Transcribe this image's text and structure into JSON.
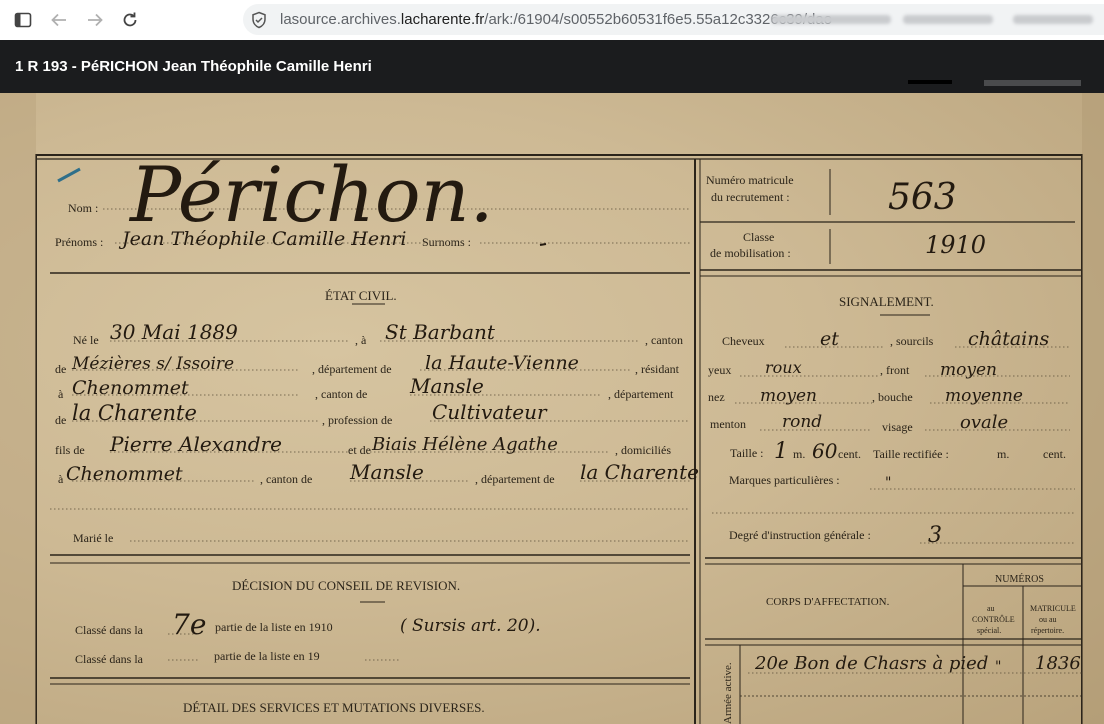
{
  "browser": {
    "url_prefix": "lasource.archives.",
    "url_host": "lacharente.fr",
    "url_path": "/ark:/61904/s00552b60531f6e5.55a12c3326c39/dao"
  },
  "viewer": {
    "title": "1 R 193 - PéRICHON Jean Théophile Camille Henri"
  },
  "document": {
    "nom_label": "Nom :",
    "nom_value": "Périchon.",
    "prenoms_label": "Prénoms :",
    "prenoms_value": "Jean Théophile Camille Henri",
    "surnoms_label": "Surnoms :",
    "matricule_label_1": "Numéro matricule",
    "matricule_label_2": "du recrutement :",
    "matricule_value": "563",
    "classe_label_1": "Classe",
    "classe_label_2": "de mobilisation :",
    "classe_value": "1910",
    "etat_civil_heading": "ÉTAT CIVIL.",
    "ne_le_label": "Né le",
    "ne_le_value": "30 Mai 1889",
    "a_label": ", à",
    "birthplace_value": "St Barbant",
    "canton_label": ", canton",
    "de_label": "de",
    "canton_value": "Mézières s/ Issoire",
    "departement_label": ", département de",
    "departement_value": "la Haute-Vienne",
    "resident_label": ", résidant",
    "a2_label": "à",
    "residence_value": "Chenommet",
    "canton2_label": ", canton de",
    "canton2_value": "Mansle",
    "departement2_label": ", département",
    "de2_label": "de",
    "departement2_value": "la Charente",
    "profession_label": ", profession de",
    "profession_value": "Cultivateur",
    "fils_de_label": "fils de",
    "father_value": "Pierre Alexandre",
    "et_de_label": "et de",
    "mother_value": "Biais Hélène Agathe",
    "domicilies_label": ", domiciliés",
    "a3_label": "à",
    "domicile_value": "Chenommet",
    "canton3_label": ", canton de",
    "canton3_value": "Mansle",
    "departement3_label": ", département de",
    "departement3_value": "la Charente",
    "marie_label": "Marié le",
    "decision_heading": "DÉCISION DU CONSEIL DE REVISION.",
    "classe_dans_la_1": "Classé dans la",
    "partie_1_value": "7e",
    "partie_label_1": "partie de la liste en 1910",
    "sursis_value": "( Sursis art. 20).",
    "classe_dans_la_2": "Classé dans la",
    "partie_label_2": "partie de la liste en 19",
    "detail_heading": "DÉTAIL DES SERVICES ET MUTATIONS DIVERSES.",
    "signalement_heading": "SIGNALEMENT.",
    "cheveux_label": "Cheveux",
    "cheveux_value": "et",
    "sourcils_label": ", sourcils",
    "sourcils_value": "châtains",
    "yeux_label": "yeux",
    "yeux_value": "roux",
    "front_label": ", front",
    "front_value": "moyen",
    "nez_label": "nez",
    "nez_value": "moyen",
    "bouche_label": ", bouche",
    "bouche_value": "moyenne",
    "menton_label": "menton",
    "menton_value": "rond",
    "visage_label": "visage",
    "visage_value": "ovale",
    "taille_label": "Taille :",
    "taille_m": "1",
    "taille_m_unit": "m.",
    "taille_cm": "60",
    "taille_cm_unit": "cent.",
    "taille_rect_label": "Taille rectifiée :",
    "taille_rect_m": "m.",
    "taille_rect_cent": "cent.",
    "marques_label": "Marques particulières :",
    "marques_value": "\"",
    "degre_label": "Degré d'instruction générale :",
    "degre_value": "3",
    "numeros_heading": "NUMÉROS",
    "corps_heading": "CORPS D'AFFECTATION.",
    "col_controle_1": "au",
    "col_controle_2": "CONTRÔLE",
    "col_controle_3": "spécial.",
    "col_matricule_1": "MATRICULE",
    "col_matricule_2": "ou au",
    "col_matricule_3": "répertoire.",
    "armee_active_label": "Armée active.",
    "corps_value": "20e Bon de Chasrs à pied",
    "controle_value": "\"",
    "matricule2_value": "1836"
  }
}
